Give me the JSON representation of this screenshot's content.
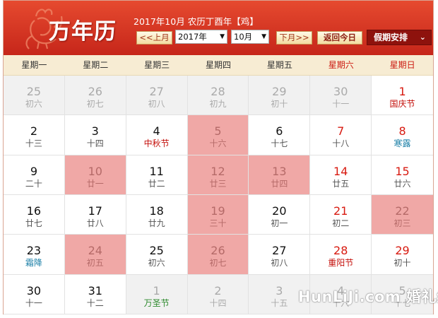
{
  "header": {
    "logo": "万年历",
    "subtitle": "2017年10月 农历丁酉年【鸡】",
    "prev_month": "<<上月",
    "year_value": "2017年",
    "month_value": "10月",
    "next_month": "下月>>",
    "today": "返回今日",
    "holiday": "假期安排"
  },
  "weekdays": [
    "星期一",
    "星期二",
    "星期三",
    "星期四",
    "星期五",
    "星期六",
    "星期日"
  ],
  "days": [
    {
      "d": "25",
      "l": "初六",
      "other": true
    },
    {
      "d": "26",
      "l": "初七",
      "other": true
    },
    {
      "d": "27",
      "l": "初八",
      "other": true
    },
    {
      "d": "28",
      "l": "初九",
      "other": true
    },
    {
      "d": "29",
      "l": "初十",
      "other": true
    },
    {
      "d": "30",
      "l": "十一",
      "other": true
    },
    {
      "d": "1",
      "l": "国庆节",
      "red": true,
      "lstyle": "fest"
    },
    {
      "d": "2",
      "l": "十三"
    },
    {
      "d": "3",
      "l": "十四"
    },
    {
      "d": "4",
      "l": "中秋节",
      "lstyle": "fest"
    },
    {
      "d": "5",
      "l": "十六",
      "hl": true
    },
    {
      "d": "6",
      "l": "十七"
    },
    {
      "d": "7",
      "l": "十八",
      "red": true
    },
    {
      "d": "8",
      "l": "寒露",
      "red": true,
      "lstyle": "term"
    },
    {
      "d": "9",
      "l": "二十"
    },
    {
      "d": "10",
      "l": "廿一",
      "hl": true
    },
    {
      "d": "11",
      "l": "廿二"
    },
    {
      "d": "12",
      "l": "廿三",
      "hl": true
    },
    {
      "d": "13",
      "l": "廿四",
      "hl": true
    },
    {
      "d": "14",
      "l": "廿五",
      "red": true
    },
    {
      "d": "15",
      "l": "廿六",
      "red": true
    },
    {
      "d": "16",
      "l": "廿七"
    },
    {
      "d": "17",
      "l": "廿八"
    },
    {
      "d": "18",
      "l": "廿九"
    },
    {
      "d": "19",
      "l": "三十",
      "hl": true
    },
    {
      "d": "20",
      "l": "初一"
    },
    {
      "d": "21",
      "l": "初二",
      "red": true
    },
    {
      "d": "22",
      "l": "初三",
      "red": true,
      "hl": true
    },
    {
      "d": "23",
      "l": "霜降",
      "lstyle": "term"
    },
    {
      "d": "24",
      "l": "初五",
      "hl": true
    },
    {
      "d": "25",
      "l": "初六"
    },
    {
      "d": "26",
      "l": "初七",
      "hl": true
    },
    {
      "d": "27",
      "l": "初八"
    },
    {
      "d": "28",
      "l": "重阳节",
      "red": true,
      "lstyle": "fest"
    },
    {
      "d": "29",
      "l": "初十",
      "red": true
    },
    {
      "d": "30",
      "l": "十一"
    },
    {
      "d": "31",
      "l": "十二"
    },
    {
      "d": "1",
      "l": "万圣节",
      "other": true,
      "lstyle": "green"
    },
    {
      "d": "2",
      "l": "十四",
      "other": true
    },
    {
      "d": "3",
      "l": "十五",
      "other": true
    },
    {
      "d": "4",
      "l": "十六",
      "other": true
    },
    {
      "d": "5",
      "l": "十七",
      "other": true
    }
  ],
  "watermark": "HunLiJi.com 婚礼纪",
  "colors": {
    "header_red": "#d2321f",
    "highlight": "#f0a8a6",
    "weekend_red": "#d81a10",
    "solar_term_blue": "#197ea6",
    "holiday_green": "#2d8a2d",
    "week_bar": "#f7ecd3"
  },
  "icons": {
    "logo_art": "rooster-icon",
    "dropdown": "triangle-down-icon",
    "holiday_menu": "chevron-down-icon"
  }
}
